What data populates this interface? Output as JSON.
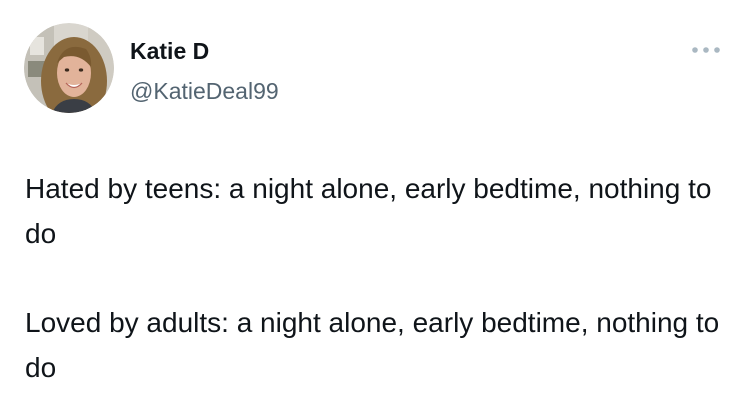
{
  "tweet": {
    "author": {
      "display_name": "Katie D",
      "handle": "@KatieDeal99",
      "avatar_icon": "profile-photo"
    },
    "more_icon": "more-horizontal-icon",
    "text_paragraphs": [
      "Hated by teens: a night alone, early bedtime, nothing to do",
      "Loved by adults: a night alone, early bedtime, nothing to do"
    ]
  },
  "colors": {
    "text_primary": "#0f1419",
    "text_secondary": "#536471",
    "more_icon": "#aab8c2",
    "background": "#ffffff"
  }
}
